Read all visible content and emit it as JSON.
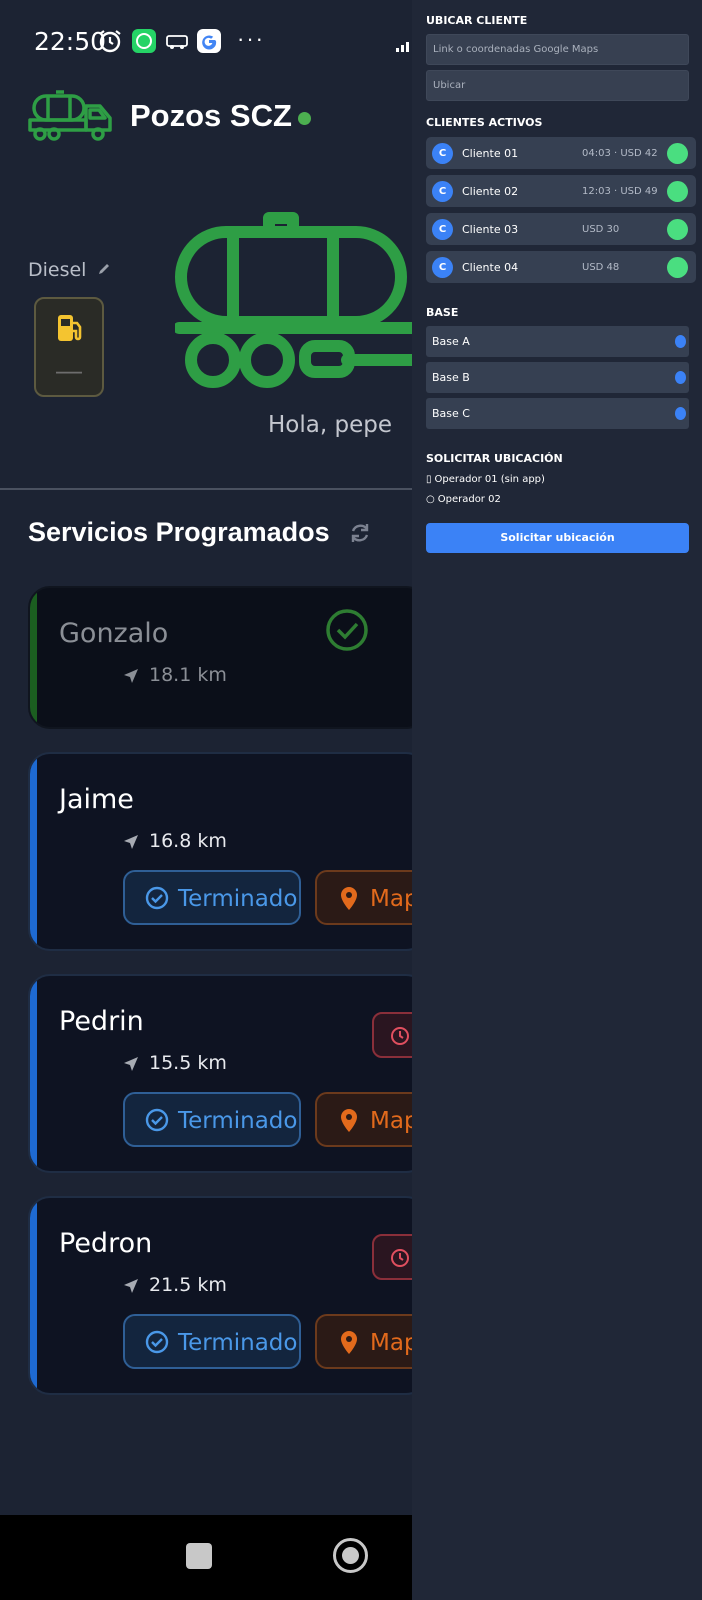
{
  "statusbar": {
    "time": "22:50",
    "more": "···"
  },
  "app": {
    "title": "Pozos SCZ",
    "online": true
  },
  "fuel": {
    "label": "Diesel",
    "value": "—"
  },
  "greeting": "Hola, pepe",
  "section": {
    "title": "Servicios Programados"
  },
  "services": [
    {
      "name": "Gonzalo",
      "distance": "18.1 km",
      "status": "done"
    },
    {
      "name": "Jaime",
      "distance": "16.8 km",
      "status": "pending",
      "terminado_label": "Terminado",
      "map_label": "Map"
    },
    {
      "name": "Pedrin",
      "distance": "15.5 km",
      "status": "pending",
      "terminado_label": "Terminado",
      "map_label": "Map"
    },
    {
      "name": "Pedron",
      "distance": "21.5 km",
      "status": "pending",
      "terminado_label": "Terminado",
      "map_label": "Map"
    }
  ],
  "panel": {
    "locate": {
      "heading": "UBICAR CLIENTE",
      "link_placeholder": "Link o coordenadas Google Maps",
      "locate_placeholder": "Ubicar"
    },
    "active": {
      "heading": "CLIENTES ACTIVOS",
      "clients": [
        {
          "initial": "C",
          "name": "Cliente 01",
          "info": "04:03 · USD 42"
        },
        {
          "initial": "C",
          "name": "Cliente 02",
          "info": "12:03 · USD 49"
        },
        {
          "initial": "C",
          "name": "Cliente 03",
          "info": "USD 30"
        },
        {
          "initial": "C",
          "name": "Cliente 04",
          "info": "USD 48"
        }
      ]
    },
    "base": {
      "heading": "BASE",
      "items": [
        {
          "name": "Base A"
        },
        {
          "name": "Base B"
        },
        {
          "name": "Base C"
        }
      ]
    },
    "request": {
      "heading": "SOLICITAR UBICACIÓN",
      "operators": [
        {
          "mark": "▯",
          "label": "Operador 01 (sin app)"
        },
        {
          "mark": "○",
          "label": "Operador 02"
        }
      ],
      "button_label": "Solicitar ubicación"
    }
  },
  "colors": {
    "accent": "#3b82f6",
    "online": "#4ade80",
    "brand_green": "#2e9e45",
    "map_orange": "#e26a1c"
  }
}
